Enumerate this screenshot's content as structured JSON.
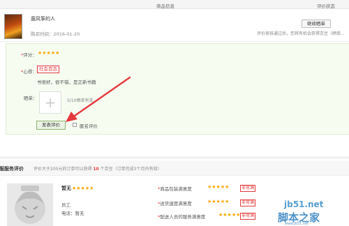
{
  "header": {
    "product_info": "商品信息",
    "review_status": "评价状态"
  },
  "product": {
    "title": "遛风筝的人",
    "purchase_time": "购买时间：2016-01-20",
    "continue_button": "继续晒单",
    "review_note": "评价审核通过后，您将有机会获得京豆（晒单..."
  },
  "review_form": {
    "rating_label": "评分：",
    "rating_stars": "★★★★★",
    "rating_value": 5,
    "experience_label": "心得：",
    "selected_tag": "社会百态",
    "comment_text": "书很好，很不错，是正新书籍",
    "photo_label": "晒单：",
    "upload_plus": "+",
    "upload_note": "0/10晒单有奖",
    "submit_button": "发表评价",
    "anonymous_label": "匿名评价"
  },
  "service_section": {
    "title": "京东客服服务评价",
    "note_prefix": "评价大于200元的订单可以获得",
    "note_count": "10",
    "note_suffix": "个京豆（订单完成3个月内有效）",
    "rep_name": "暂无",
    "rep_stars": "★★★★★",
    "rep_role": "员工",
    "rep_phone": "电话：暂无",
    "ratings": [
      {
        "label": "商品包装满意度",
        "stars": "★★★★★",
        "badge": "非常满意"
      },
      {
        "label": "送货速度满意度",
        "stars": "★★★★★",
        "badge": "非常满意"
      },
      {
        "label": "配送人员的服务满意度",
        "stars": "★★★★★",
        "badge": "非常满意"
      }
    ]
  },
  "watermark": {
    "site": "jb51.net",
    "brand": "脚本之家",
    "url": "www.jb51.net"
  },
  "colors": {
    "accent_red": "#e4393c",
    "star": "#f7a600",
    "form_bg": "#f7fcf1"
  }
}
